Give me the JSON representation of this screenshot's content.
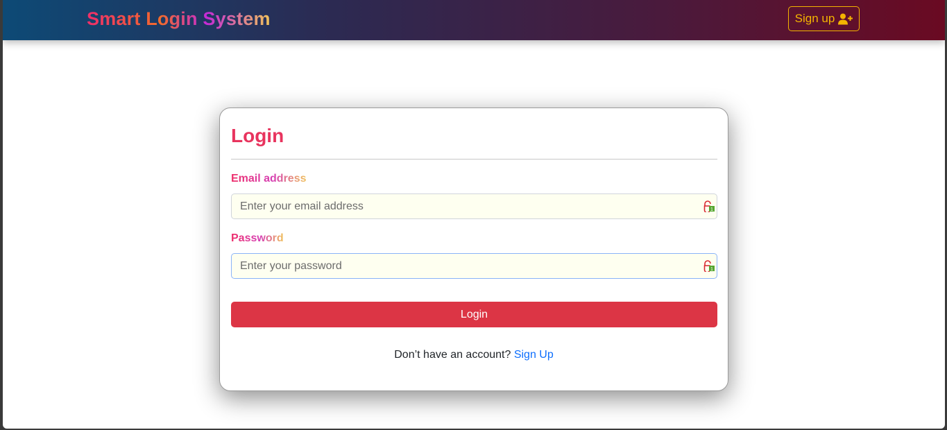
{
  "navbar": {
    "brand": "Smart Login System",
    "signup_label": "Sign up"
  },
  "card": {
    "title": "Login",
    "email": {
      "label": "Email address",
      "placeholder": "Enter your email address",
      "value": ""
    },
    "password": {
      "label": "Password",
      "placeholder": "Enter your password",
      "value": ""
    },
    "submit_label": "Login",
    "footer_prompt": "Don’t have an account?",
    "footer_link": "Sign Up"
  },
  "colors": {
    "accent": "#dc3545",
    "link": "#0d6efd",
    "title": "#e8345e",
    "signup_button": "#f4b400"
  },
  "icons": {
    "signup": "user-plus-icon",
    "password_manager": "password-manager-icon"
  }
}
